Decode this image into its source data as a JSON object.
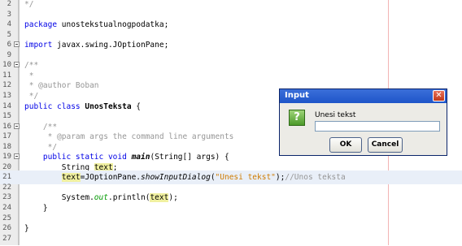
{
  "editor": {
    "lines": [
      {
        "num": "2",
        "hl": false,
        "fold": false,
        "html": "<span class=\"cm\">*/</span>"
      },
      {
        "num": "3",
        "hl": false,
        "fold": false,
        "html": ""
      },
      {
        "num": "4",
        "hl": false,
        "fold": false,
        "html": "<span class=\"kw\">package</span> unostekstualnogpodatka;"
      },
      {
        "num": "5",
        "hl": false,
        "fold": false,
        "html": ""
      },
      {
        "num": "6",
        "hl": false,
        "fold": true,
        "html": "<span class=\"kw\">import</span> javax.swing.JOptionPane;"
      },
      {
        "num": "9",
        "hl": false,
        "fold": false,
        "html": ""
      },
      {
        "num": "10",
        "hl": false,
        "fold": true,
        "html": "<span class=\"cm\">/**</span>"
      },
      {
        "num": "11",
        "hl": false,
        "fold": false,
        "html": "<span class=\"cm\"> *</span>"
      },
      {
        "num": "12",
        "hl": false,
        "fold": false,
        "html": "<span class=\"cm\"> * @author Boban</span>"
      },
      {
        "num": "13",
        "hl": false,
        "fold": false,
        "html": "<span class=\"cm\"> */</span>"
      },
      {
        "num": "14",
        "hl": false,
        "fold": false,
        "html": "<span class=\"kw\">public class</span> <span class=\"b\">UnosTeksta</span> {"
      },
      {
        "num": "15",
        "hl": false,
        "fold": false,
        "html": ""
      },
      {
        "num": "16",
        "hl": false,
        "fold": true,
        "html": "    <span class=\"cm\">/**</span>"
      },
      {
        "num": "17",
        "hl": false,
        "fold": false,
        "html": "<span class=\"cm\">     * @param args the command line arguments</span>"
      },
      {
        "num": "18",
        "hl": false,
        "fold": false,
        "html": "<span class=\"cm\">     */</span>"
      },
      {
        "num": "19",
        "hl": false,
        "fold": true,
        "html": "    <span class=\"kw\">public static void</span> <span class=\"bi\">main</span>(String[] args) {"
      },
      {
        "num": "20",
        "hl": false,
        "fold": false,
        "html": "        String <span class=\"occ\">text</span>;"
      },
      {
        "num": "21",
        "hl": true,
        "fold": false,
        "html": "        <span class=\"occ\">text</span>=JOptionPane.<span class=\"it\">showInputDialog</span>(<span class=\"str\">\"Unesi tekst\"</span>);<span class=\"cm\">//Unos teksta</span>"
      },
      {
        "num": "22",
        "hl": false,
        "fold": false,
        "html": ""
      },
      {
        "num": "23",
        "hl": false,
        "fold": false,
        "html": "        System.<span class=\"grn\">out</span>.println(<span class=\"occ\">text</span>);"
      },
      {
        "num": "24",
        "hl": false,
        "fold": false,
        "html": "    }"
      },
      {
        "num": "25",
        "hl": false,
        "fold": false,
        "html": ""
      },
      {
        "num": "26",
        "hl": false,
        "fold": false,
        "html": "}"
      },
      {
        "num": "27",
        "hl": false,
        "fold": false,
        "html": ""
      }
    ]
  },
  "dialog": {
    "title": "Input",
    "close_symbol": "✕",
    "icon_symbol": "?",
    "icon": "question-icon",
    "prompt": "Unesi tekst",
    "input_value": "",
    "ok_label": "OK",
    "cancel_label": "Cancel"
  },
  "colors": {
    "keyword": "#0000e6",
    "comment": "#969696",
    "string": "#ce7b00",
    "highlight_line": "#e9eff8",
    "occurrence": "#f0f0a0",
    "titlebar": "#1e55c9"
  }
}
